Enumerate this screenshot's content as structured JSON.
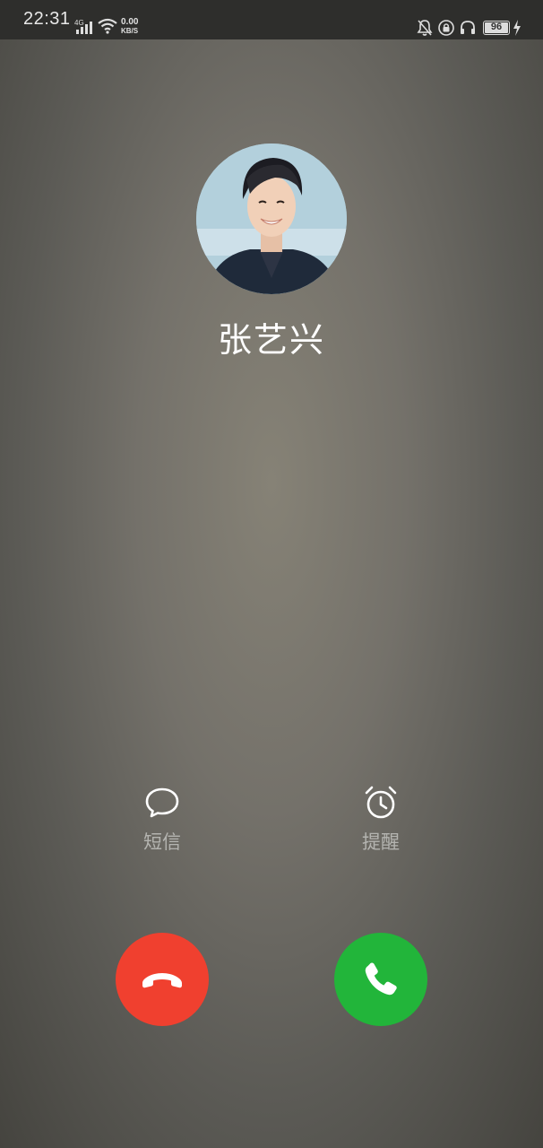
{
  "status_bar": {
    "time": "22:31",
    "network_type": "4G",
    "data_speed_value": "0.00",
    "data_speed_unit": "KB/S",
    "battery_level": "96",
    "icons": [
      "signal-icon",
      "wifi-icon",
      "bell-off-icon",
      "lock-rotation-icon",
      "headphones-icon",
      "battery-icon",
      "charging-icon"
    ]
  },
  "caller": {
    "name": "张艺兴",
    "avatar": "contact-photo"
  },
  "actions": {
    "message_label": "短信",
    "message_icon": "message-icon",
    "remind_label": "提醒",
    "remind_icon": "alarm-clock-icon"
  },
  "call_buttons": {
    "decline_icon": "hang-up-icon",
    "decline_color": "#f0402f",
    "accept_icon": "phone-icon",
    "accept_color": "#22b53a"
  }
}
